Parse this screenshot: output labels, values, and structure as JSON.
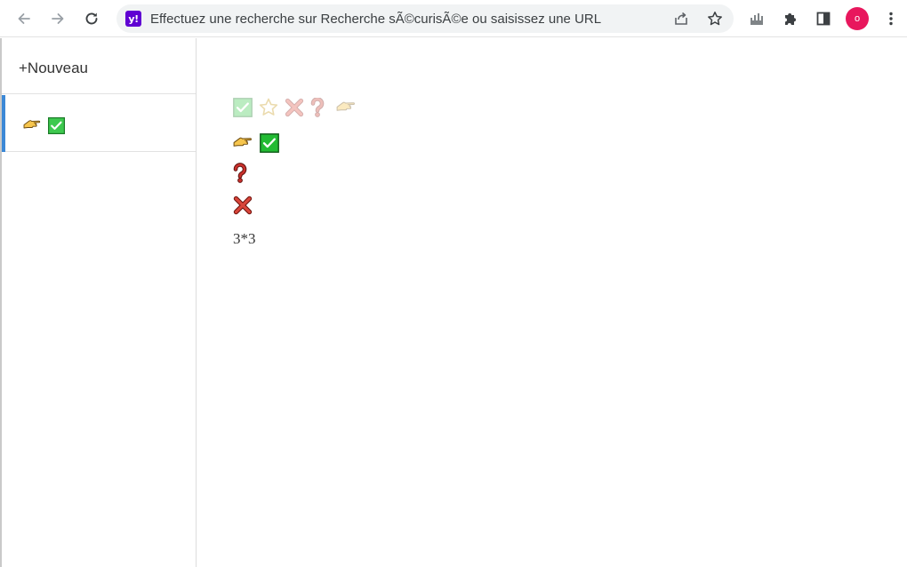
{
  "browser": {
    "omnibox": {
      "site_badge": "y!",
      "placeholder": "Effectuez une recherche sur Recherche sÃ©curisÃ©e ou saisissez une URL"
    },
    "profile_initial": "o",
    "icons": [
      "back-arrow-icon",
      "forward-arrow-icon",
      "reload-icon",
      "share-icon",
      "bookmark-star-icon",
      "extension-castle-icon",
      "puzzle-extensions-icon",
      "side-panel-icon",
      "more-vertical-icon"
    ]
  },
  "sidebar": {
    "new_label": "+Nouveau",
    "items": [
      {
        "icons": [
          "pointing-hand-icon",
          "check-box-icon"
        ],
        "active": true
      }
    ]
  },
  "main": {
    "palette_icons": [
      "check-box-icon",
      "star-icon",
      "cross-icon",
      "question-icon",
      "pointing-hand-icon"
    ],
    "lines": [
      {
        "icons": [
          "pointing-hand-icon",
          "check-box-icon"
        ]
      },
      {
        "icons": [
          "question-icon"
        ]
      },
      {
        "icons": [
          "cross-icon"
        ]
      }
    ],
    "expression": "3*3"
  },
  "colors": {
    "accent": "#3c88d6",
    "check_green": "#22bb33",
    "cross_red": "#d9453a",
    "question_red": "#c9302c",
    "hand_yellow": "#f4c430",
    "avatar": "#e8175d",
    "badge_purple": "#6001d2"
  }
}
